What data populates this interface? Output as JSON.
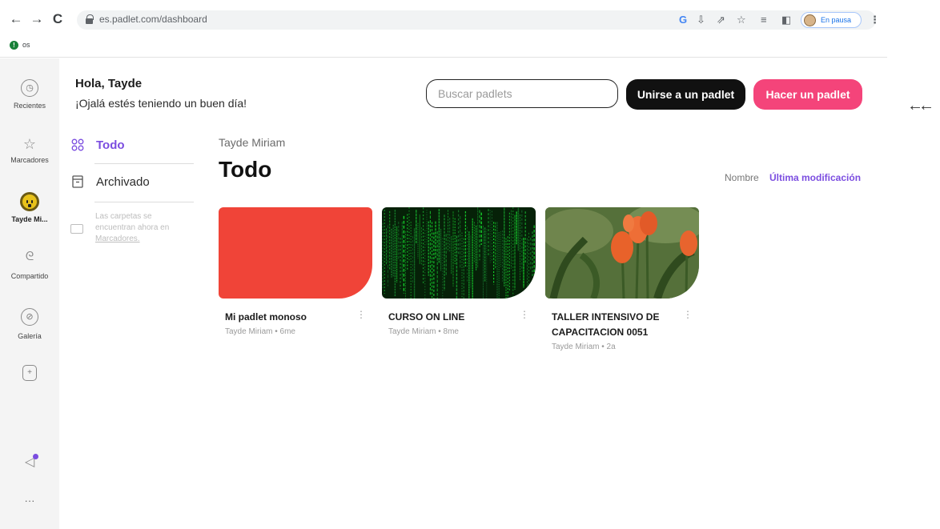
{
  "browser": {
    "back_icon": "←",
    "forward_icon": "→",
    "reload_icon": "C",
    "url": "es.padlet.com/dashboard",
    "profile_status": "En pausa",
    "bookmark_label": "os"
  },
  "rail": {
    "items": [
      {
        "label": "Recientes",
        "icon": "clock-icon"
      },
      {
        "label": "Marcadores",
        "icon": "star-icon"
      },
      {
        "label": "Tayde Mi...",
        "icon": "avatar-icon"
      },
      {
        "label": "Compartido",
        "icon": "handshake-icon"
      },
      {
        "label": "Galería",
        "icon": "compass-icon"
      },
      {
        "label": "",
        "icon": "new-padlet-icon"
      }
    ],
    "more_label": "···"
  },
  "header": {
    "greeting": "Hola, Tayde",
    "subtitle": "¡Ojalá estés teniendo un buen día!",
    "search_placeholder": "Buscar padlets",
    "join_label": "Unirse a un padlet",
    "make_label": "Hacer un padlet",
    "edge_text": "←←"
  },
  "subnav": {
    "all_label": "Todo",
    "archived_label": "Archivado",
    "folder_note": "Las carpetas se encuentran ahora en",
    "folder_link": "Marcadores."
  },
  "main": {
    "owner": "Tayde Miriam",
    "title": "Todo",
    "sort_name": "Nombre",
    "sort_modified": "Última modificación",
    "cards": [
      {
        "title": "Mi padlet monoso",
        "meta": "Tayde Miriam • 6me",
        "thumb": "red",
        "color": "#f04438"
      },
      {
        "title": "CURSO ON LINE",
        "meta": "Tayde Miriam • 8me",
        "thumb": "matrix",
        "color": "#0a2a10"
      },
      {
        "title": "TALLER INTENSIVO DE CAPACITACION 0051",
        "meta": "Tayde Miriam • 2a",
        "thumb": "tulips",
        "color": "#5d7a3e"
      }
    ]
  },
  "colors": {
    "accent": "#7b4de0",
    "pink": "#f4447a",
    "dark": "#111111"
  }
}
